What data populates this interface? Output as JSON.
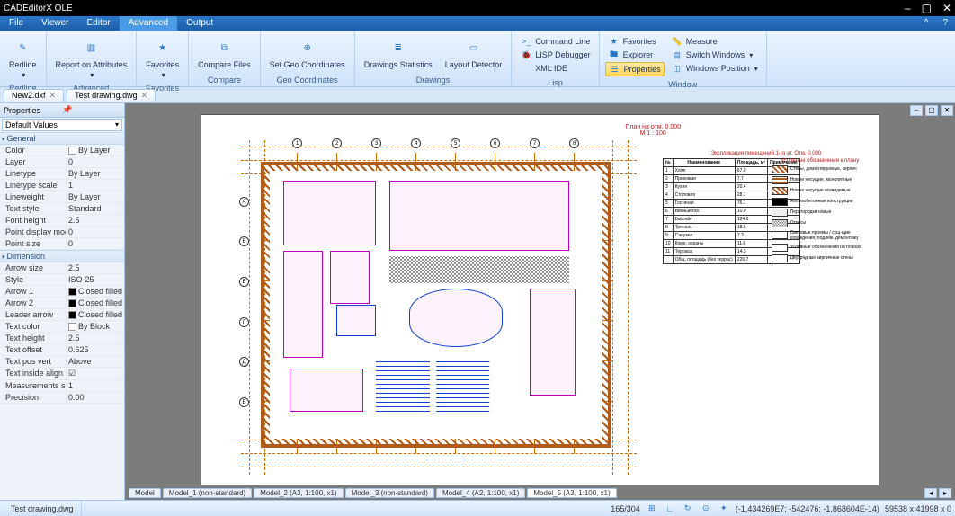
{
  "app": {
    "title": "CADEditorX OLE"
  },
  "window_buttons": {
    "min": "–",
    "max": "▢",
    "close": "✕"
  },
  "menubar": {
    "tabs": [
      "File",
      "Viewer",
      "Editor",
      "Advanced",
      "Output"
    ],
    "active": 3
  },
  "ribbon": {
    "groups": [
      {
        "name": "Redline",
        "buttons": [
          {
            "label": "Redline",
            "icon": "✎",
            "dd": true
          }
        ]
      },
      {
        "name": "Advanced",
        "buttons": [
          {
            "label": "Report on Attributes",
            "icon": "▥",
            "dd": true
          }
        ]
      },
      {
        "name": "Favorites",
        "buttons": [
          {
            "label": "Favorites",
            "icon": "★",
            "dd": true
          }
        ]
      },
      {
        "name": "Compare",
        "buttons": [
          {
            "label": "Compare Files",
            "icon": "⧉"
          }
        ]
      },
      {
        "name": "Geo Coordinates",
        "buttons": [
          {
            "label": "Set Geo Coordinates",
            "icon": "⊕"
          }
        ]
      },
      {
        "name": "Drawings",
        "buttons": [
          {
            "label": "Drawings Statistics",
            "icon": "≣"
          },
          {
            "label": "Layout Detector",
            "icon": "▭"
          }
        ]
      }
    ],
    "lisp_group": {
      "label": "Lisp",
      "items": [
        {
          "icon": ">_",
          "label": "Command Line"
        },
        {
          "icon": "🐞",
          "label": "LISP Debugger"
        },
        {
          "icon": "</>",
          "label": "XML IDE"
        }
      ]
    },
    "window_group": {
      "label": "Window",
      "cols": [
        [
          {
            "icon": "★",
            "label": "Favorites"
          },
          {
            "icon": "🖿",
            "label": "Explorer"
          },
          {
            "icon": "☰",
            "label": "Properties",
            "highlight": true
          }
        ],
        [
          {
            "icon": "📏",
            "label": "Measure"
          },
          {
            "icon": "▤",
            "label": "Switch Windows",
            "dd": true
          },
          {
            "icon": "◫",
            "label": "Windows Position",
            "dd": true
          }
        ]
      ]
    }
  },
  "doctabs": [
    "New2.dxf",
    "Test drawing.dwg"
  ],
  "props": {
    "title": "Properties",
    "default": "Default Values",
    "sections": [
      {
        "name": "General",
        "rows": [
          {
            "k": "Color",
            "v": "By Layer",
            "swatch": "white"
          },
          {
            "k": "Layer",
            "v": "0"
          },
          {
            "k": "Linetype",
            "v": "By Layer"
          },
          {
            "k": "Linetype scale",
            "v": "1"
          },
          {
            "k": "Lineweight",
            "v": "By Layer"
          },
          {
            "k": "Text style",
            "v": "Standard"
          },
          {
            "k": "Font height",
            "v": "2.5"
          },
          {
            "k": "Point display mode",
            "v": "0"
          },
          {
            "k": "Point size",
            "v": "0"
          }
        ]
      },
      {
        "name": "Dimension",
        "rows": [
          {
            "k": "Arrow size",
            "v": "2.5"
          },
          {
            "k": "Style",
            "v": "ISO-25"
          },
          {
            "k": "Arrow 1",
            "v": "Closed filled",
            "swatch": "black"
          },
          {
            "k": "Arrow 2",
            "v": "Closed filled",
            "swatch": "black"
          },
          {
            "k": "Leader arrow",
            "v": "Closed filled",
            "swatch": "black"
          },
          {
            "k": "Text color",
            "v": "By Block",
            "swatch": "white"
          },
          {
            "k": "Text height",
            "v": "2.5"
          },
          {
            "k": "Text offset",
            "v": "0.625"
          },
          {
            "k": "Text pos vert",
            "v": "Above"
          },
          {
            "k": "Text inside align",
            "v": "",
            "checked": true
          },
          {
            "k": "Measurements scale",
            "v": "1"
          },
          {
            "k": "Precision",
            "v": "0.00"
          }
        ]
      }
    ]
  },
  "sheet_info": {
    "line1": "План на отм. 0.000",
    "line2": "М 1 : 100"
  },
  "legend": {
    "title": "Экспликация помещений 1-го эт. Отм. 0.000",
    "keys_title": "Условные обозначения к плану",
    "headers": [
      "№",
      "Наименование",
      "Площадь, м²",
      "Примечание"
    ],
    "rows": [
      [
        "1",
        "Холл",
        "67.0",
        ""
      ],
      [
        "2",
        "Прихожая",
        "7.7",
        ""
      ],
      [
        "3",
        "Кухня",
        "20.4",
        ""
      ],
      [
        "4",
        "Столовая",
        "28.1",
        ""
      ],
      [
        "5",
        "Гостиная",
        "76.1",
        ""
      ],
      [
        "6",
        "Винный пог.",
        "10.0",
        ""
      ],
      [
        "7",
        "Бассейн",
        "124.8",
        ""
      ],
      [
        "8",
        "Тренаж.",
        "18.5",
        ""
      ],
      [
        "9",
        "Санузел",
        "7.3",
        ""
      ],
      [
        "10",
        "Комн. охраны",
        "11.6",
        ""
      ],
      [
        "11",
        "Терраса",
        "14.3",
        ""
      ],
      [
        "",
        "Общ. площадь (без террас)",
        "220.7",
        ""
      ]
    ],
    "keys": [
      {
        "cls": "brick",
        "t": "Стены, демонтируемые, кирпич"
      },
      {
        "cls": "brick2",
        "t": "Новые несущие, монолитные"
      },
      {
        "cls": "brick",
        "t": "Новые несущие возводимые"
      },
      {
        "cls": "solid",
        "t": "Железобетонные конструкции"
      },
      {
        "cls": "light",
        "t": "Перегородки новые"
      },
      {
        "cls": "hatch",
        "t": "Откосы"
      },
      {
        "cls": "",
        "t": "Световые проемы / сущ-щие ограждения, подлеж. демонтажу"
      },
      {
        "cls": "",
        "t": "Условные обозначения на планах"
      },
      {
        "cls": "",
        "t": "Двухрядные кирпичные стены"
      }
    ]
  },
  "modeltabs": {
    "tabs": [
      "Model",
      "Model_1 (non-standard)",
      "Model_2 (A3, 1:100, x1)",
      "Model_3 (non-standard)",
      "Model_4 (A2, 1:100, x1)",
      "Model_5 (A3, 1:100, x1)"
    ],
    "active": 5
  },
  "status": {
    "file": "Test drawing.dwg",
    "progress": "165/304",
    "coords": "(-1,434269E7; -542476; -1,868604E-14)",
    "size": "59538 x 41998 x 0"
  }
}
